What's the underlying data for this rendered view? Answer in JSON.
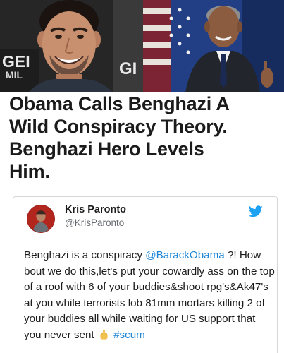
{
  "photos": {
    "left_backdrop_text_1": "GEI",
    "left_backdrop_text_2": "MIL",
    "right_backdrop_text": "GI"
  },
  "headline": {
    "text": "Obama Calls Benghazi A\nWild Conspiracy Theory.\nBenghazi Hero Levels\nHim."
  },
  "tweet": {
    "display_name": "Kris Paronto",
    "handle": "@KrisParonto",
    "body_intro": "Benghazi is a conspiracy ",
    "mention": "@BarackObama",
    "body_main": " ?! How bout we do this,let's put your cowardly ass on the top of a roof with 6 of your buddies&shoot rpg's&Ak47's at you while terrorists lob 81mm mortars killing 2 of your buddies all while waiting for US support that you never sent ",
    "hashtag": "#scum",
    "emoji": "middle-finger-emoji-icon"
  },
  "colors": {
    "link": "#1b84d6",
    "twitter_brand": "#1da1f2",
    "headline_text": "#1b1b1b"
  }
}
